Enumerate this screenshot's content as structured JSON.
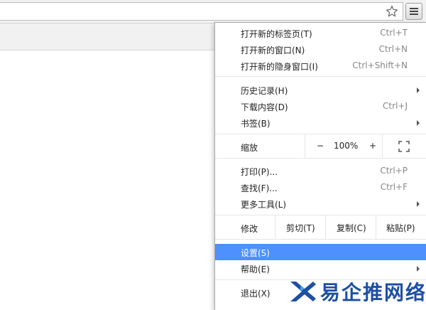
{
  "toolbar": {
    "bookmark_star_icon": "star-outline-icon",
    "menu_icon": "hamburger-menu-icon"
  },
  "menu": {
    "new_tab": {
      "label": "打开新的标签页(T)",
      "shortcut": "Ctrl+T"
    },
    "new_window": {
      "label": "打开新的窗口(N)",
      "shortcut": "Ctrl+N"
    },
    "new_incognito": {
      "label": "打开新的隐身窗口(I)",
      "shortcut": "Ctrl+Shift+N"
    },
    "history": {
      "label": "历史记录(H)"
    },
    "downloads": {
      "label": "下载内容(D)",
      "shortcut": "Ctrl+J"
    },
    "bookmarks": {
      "label": "书签(B)"
    },
    "zoom": {
      "label": "缩放",
      "minus": "−",
      "value": "100%",
      "plus": "+"
    },
    "print": {
      "label": "打印(P)...",
      "shortcut": "Ctrl+P"
    },
    "find": {
      "label": "查找(F)...",
      "shortcut": "Ctrl+F"
    },
    "more_tools": {
      "label": "更多工具(L)"
    },
    "edit": {
      "label": "修改",
      "cut": "剪切(T)",
      "copy": "复制(C)",
      "paste": "粘贴(P)"
    },
    "settings": {
      "label": "设置(S)"
    },
    "help": {
      "label": "帮助(E)"
    },
    "exit": {
      "label": "退出(X)"
    }
  },
  "watermark": {
    "text": "易企推网络"
  },
  "colors": {
    "highlight": "#4d90fe",
    "logo_blue": "#1d4fa3"
  }
}
